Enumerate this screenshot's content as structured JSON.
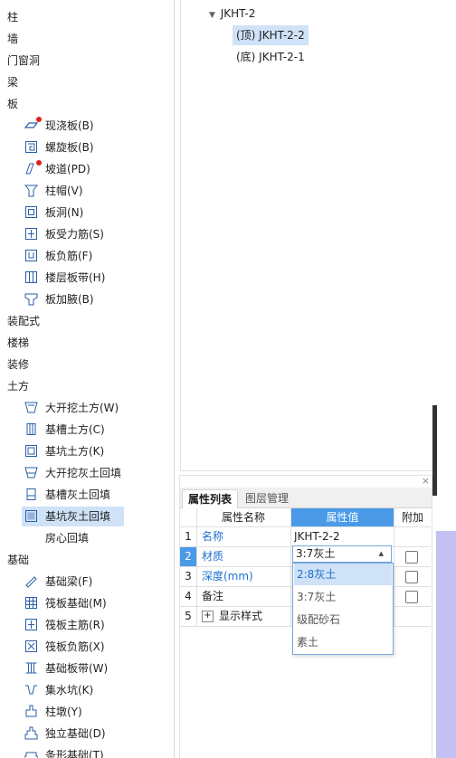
{
  "tree": {
    "categories_top": [
      "柱",
      "墙",
      "门窗洞",
      "梁",
      "板"
    ],
    "board_children": [
      {
        "icon": "cast-slab-icon",
        "label": "现浇板(B)",
        "alert": true
      },
      {
        "icon": "spiral-slab-icon",
        "label": "螺旋板(B)",
        "alert": false
      },
      {
        "icon": "ramp-icon",
        "label": "坡道(PD)",
        "alert": true
      },
      {
        "icon": "column-cap-icon",
        "label": "柱帽(V)",
        "alert": false
      },
      {
        "icon": "slab-hole-icon",
        "label": "板洞(N)",
        "alert": false
      },
      {
        "icon": "slab-rebar-icon",
        "label": "板受力筋(S)",
        "alert": false
      },
      {
        "icon": "neg-rebar-icon",
        "label": "板负筋(F)",
        "alert": false
      },
      {
        "icon": "floor-band-icon",
        "label": "楼层板带(H)",
        "alert": false
      },
      {
        "icon": "slab-haunch-icon",
        "label": "板加腋(B)",
        "alert": false
      }
    ],
    "categories_mid": [
      "装配式",
      "楼梯",
      "装修",
      "土方"
    ],
    "earth_children": [
      {
        "icon": "open-excavation-icon",
        "label": "大开挖土方(W)"
      },
      {
        "icon": "trench-earth-icon",
        "label": "基槽土方(C)"
      },
      {
        "icon": "pit-earth-icon",
        "label": "基坑土方(K)"
      },
      {
        "icon": "open-backfill-icon",
        "label": "大开挖灰土回填"
      },
      {
        "icon": "trench-backfill-icon",
        "label": "基槽灰土回填"
      },
      {
        "icon": "pit-backfill-icon",
        "label": "基坑灰土回填",
        "selected": true
      },
      {
        "icon": "room-backfill-icon",
        "label": "房心回填"
      }
    ],
    "category_foundation": "基础",
    "foundation_children": [
      {
        "icon": "foundation-beam-icon",
        "label": "基础梁(F)"
      },
      {
        "icon": "raft-foundation-icon",
        "label": "筏板基础(M)"
      },
      {
        "icon": "raft-main-rebar-icon",
        "label": "筏板主筋(R)"
      },
      {
        "icon": "raft-neg-rebar-icon",
        "label": "筏板负筋(X)"
      },
      {
        "icon": "foundation-band-icon",
        "label": "基础板带(W)"
      },
      {
        "icon": "sump-icon",
        "label": "集水坑(K)"
      },
      {
        "icon": "pier-icon",
        "label": "柱墩(Y)"
      },
      {
        "icon": "isolated-foundation-icon",
        "label": "独立基础(D)"
      },
      {
        "icon": "strip-foundation-icon",
        "label": "条形基础(T)"
      }
    ]
  },
  "component_list": {
    "group": "JKHT-2",
    "items": [
      {
        "label": "(顶) JKHT-2-2",
        "selected": true
      },
      {
        "label": "(底) JKHT-2-1",
        "selected": false
      }
    ]
  },
  "property_panel": {
    "close": "×",
    "tabs": [
      "属性列表",
      "图层管理"
    ],
    "headers": {
      "name": "属性名称",
      "value": "属性值",
      "extra": "附加"
    },
    "rows": [
      {
        "num": "1",
        "name": "名称",
        "value": "JKHT-2-2",
        "has_check": false
      },
      {
        "num": "2",
        "name": "材质",
        "value": "3:7灰土",
        "has_check": true
      },
      {
        "num": "3",
        "name": "深度(mm)",
        "value": "",
        "has_check": true
      },
      {
        "num": "4",
        "name": "备注",
        "value": "",
        "has_check": true
      },
      {
        "num": "5",
        "name": "显示样式",
        "value": "",
        "has_check": false,
        "expand": "+"
      }
    ],
    "dropdown_options": [
      "2:8灰土",
      "3:7灰土",
      "级配砂石",
      "素土"
    ],
    "dropdown_selected": "2:8灰土"
  },
  "colors": {
    "accent": "#4a9ae8",
    "selection": "#cfe2f7",
    "link": "#1d6fd0",
    "alert": "#e02020",
    "side_panel": "#c3c0f4"
  }
}
